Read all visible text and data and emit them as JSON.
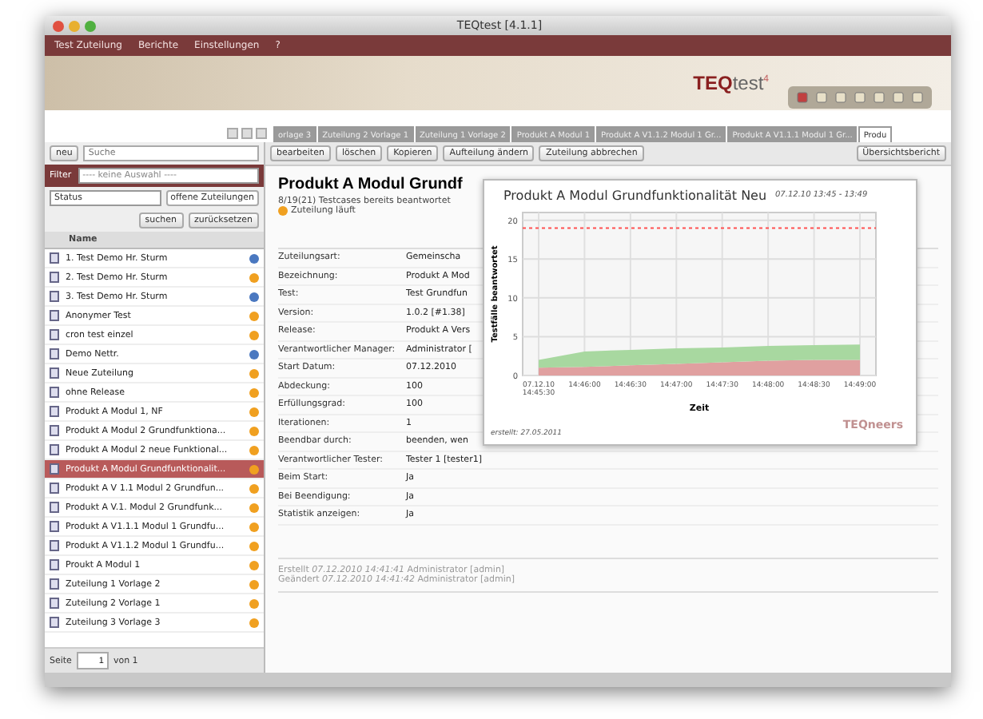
{
  "window": {
    "title": "TEQtest [4.1.1]"
  },
  "menu": [
    "Test Zuteilung",
    "Berichte",
    "Einstellungen",
    "?"
  ],
  "logo": {
    "brand": "TEQ",
    "product": "test",
    "version": "4"
  },
  "tabs": [
    {
      "label": "orlage 3",
      "selected": false
    },
    {
      "label": "Zuteilung 2 Vorlage 1",
      "selected": false
    },
    {
      "label": "Zuteilung 1 Vorlage 2",
      "selected": false
    },
    {
      "label": "Produkt A Modul 1",
      "selected": false
    },
    {
      "label": "Produkt A V1.1.2 Modul 1 Gr...",
      "selected": false
    },
    {
      "label": "Produkt A V1.1.1 Modul 1 Gr...",
      "selected": false
    },
    {
      "label": "Produ",
      "selected": true
    }
  ],
  "left": {
    "new_button": "neu",
    "search": {
      "placeholder": "Suche"
    },
    "filter_label": "Filter",
    "filter_value": "---- keine Auswahl ----",
    "status_select": "Status",
    "status_tag": "offene Zuteilungen",
    "search_button": "suchen",
    "reset_button": "zurücksetzen",
    "column": "Name",
    "items": [
      {
        "name": "1. Test Demo Hr. Sturm",
        "color": "#4a78c0",
        "selected": false
      },
      {
        "name": "2. Test Demo Hr. Sturm",
        "color": "#f0a020",
        "selected": false
      },
      {
        "name": "3. Test Demo Hr. Sturm",
        "color": "#4a78c0",
        "selected": false
      },
      {
        "name": "Anonymer Test",
        "color": "#f0a020",
        "selected": false
      },
      {
        "name": "cron test einzel",
        "color": "#f0a020",
        "selected": false
      },
      {
        "name": "Demo Nettr.",
        "color": "#4a78c0",
        "selected": false
      },
      {
        "name": "Neue Zuteilung",
        "color": "#f0a020",
        "selected": false
      },
      {
        "name": "ohne Release",
        "color": "#f0a020",
        "selected": false
      },
      {
        "name": "Produkt A Modul 1, NF",
        "color": "#f0a020",
        "selected": false
      },
      {
        "name": "Produkt A Modul 2 Grundfunktiona...",
        "color": "#f0a020",
        "selected": false
      },
      {
        "name": "Produkt A Modul 2 neue Funktional...",
        "color": "#f0a020",
        "selected": false
      },
      {
        "name": "Produkt A Modul Grundfunktionalit...",
        "color": "#f0a020",
        "selected": true
      },
      {
        "name": "Produkt A V 1.1 Modul 2 Grundfun...",
        "color": "#f0a020",
        "selected": false
      },
      {
        "name": "Produkt A V.1. Modul 2 Grundfunk...",
        "color": "#f0a020",
        "selected": false
      },
      {
        "name": "Produkt A V1.1.1 Modul 1 Grundfu...",
        "color": "#f0a020",
        "selected": false
      },
      {
        "name": "Produkt A V1.1.2 Modul 1 Grundfu...",
        "color": "#f0a020",
        "selected": false
      },
      {
        "name": "Proukt A Modul 1",
        "color": "#f0a020",
        "selected": false
      },
      {
        "name": "Zuteilung 1 Vorlage 2",
        "color": "#f0a020",
        "selected": false
      },
      {
        "name": "Zuteilung 2 Vorlage 1",
        "color": "#f0a020",
        "selected": false
      },
      {
        "name": "Zuteilung 3 Vorlage 3",
        "color": "#f0a020",
        "selected": false
      }
    ],
    "pager": {
      "page_label": "Seite",
      "page": "1",
      "of": "von 1"
    }
  },
  "toolbar": [
    "bearbeiten",
    "löschen",
    "Kopieren",
    "Aufteilung ändern",
    "Zuteilung abbrechen"
  ],
  "report_button": "Übersichtsbericht",
  "detail": {
    "heading": "Produkt A Modul Grundf",
    "answered": "8/19(21) Testcases bereits beantwortet",
    "status": "Zuteilung läuft",
    "fields": [
      {
        "label": "Zuteilungsart:",
        "value": "Gemeinscha"
      },
      {
        "label": "Bezeichnung:",
        "value": "Produkt A Mod"
      },
      {
        "label": "Test:",
        "value": "Test Grundfun"
      },
      {
        "label": "Version:",
        "value": "1.0.2 [#1.38]"
      },
      {
        "label": "Release:",
        "value": "Produkt A Vers"
      },
      {
        "label": "Verantwortlicher Manager:",
        "value": "Administrator ["
      },
      {
        "label": "Start Datum:",
        "value": "07.12.2010"
      },
      {
        "label": "Abdeckung:",
        "value": "100"
      },
      {
        "label": "Erfüllungsgrad:",
        "value": "100"
      },
      {
        "label": "Iterationen:",
        "value": "1"
      },
      {
        "label": "Beendbar durch:",
        "value": "beenden, wen"
      },
      {
        "label": "Verantwortlicher Tester:",
        "value": "Tester 1 [tester1]"
      },
      {
        "label": "Beim Start:",
        "value": "Ja"
      },
      {
        "label": "Bei Beendigung:",
        "value": "Ja"
      },
      {
        "label": "Statistik anzeigen:",
        "value": "Ja"
      }
    ],
    "meta": [
      "Erstellt *07.12.2010 14:41:41* Administrator [admin]",
      "Geändert *07.12.2010 14:41:42* Administrator [admin]"
    ]
  },
  "popup": {
    "subtitle": "07.12.10 13:45 - 13:49",
    "created": "erstellt: 27.05.2011",
    "logo": "TEQneers",
    "chart_data": {
      "type": "area",
      "title": "Produkt A Modul Grundfunktionalität Neu",
      "xlabel": "Zeit",
      "ylabel": "Testfälle beantwortet",
      "categories": [
        "07.12.10 14:45:30",
        "14:46:00",
        "14:46:30",
        "14:47:00",
        "14:47:30",
        "14:48:00",
        "14:48:30",
        "14:49:00"
      ],
      "stacked": true,
      "ylim": [
        0,
        21
      ],
      "yticks": [
        0,
        5,
        10,
        15,
        20
      ],
      "series": [
        {
          "color": "#e0a0a0",
          "values": [
            1,
            1.1,
            1.3,
            1.5,
            1.7,
            1.9,
            2,
            2
          ]
        },
        {
          "color": "#a8d8a0",
          "values": [
            1,
            2,
            2,
            2,
            1.9,
            1.9,
            1.9,
            2
          ]
        }
      ],
      "grid": true,
      "ref_lines": [
        {
          "axis": "y",
          "value": 19,
          "color": "#ff5050"
        }
      ]
    }
  }
}
